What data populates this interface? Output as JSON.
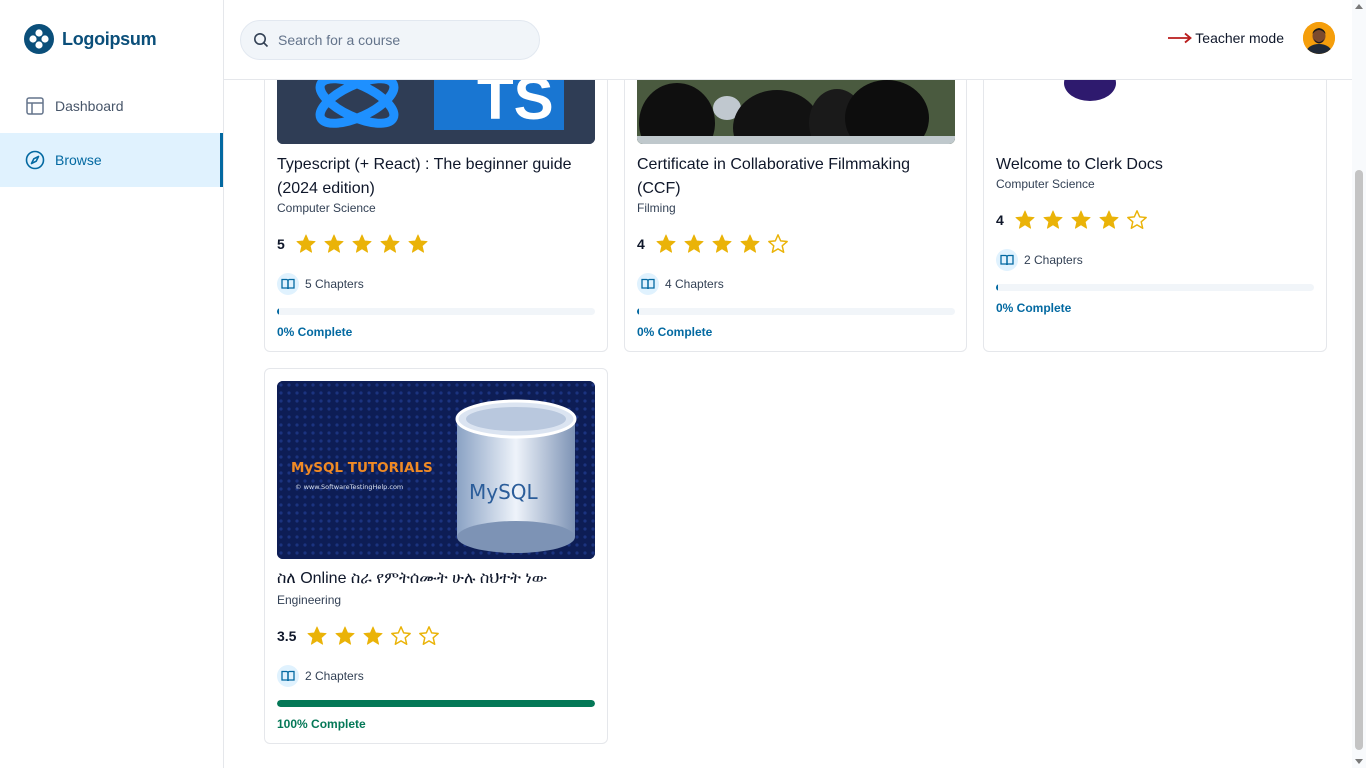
{
  "app": {
    "logo_text": "Logoipsum",
    "brand_color": "#0b4f7a",
    "accent_color": "#0369a1",
    "complete_color": "#047857"
  },
  "sidebar": {
    "items": [
      {
        "label": "Dashboard",
        "icon": "layout-icon",
        "active": false
      },
      {
        "label": "Browse",
        "icon": "compass-icon",
        "active": true
      }
    ]
  },
  "header": {
    "search_placeholder": "Search for a course",
    "teacher_mode_label": "Teacher mode"
  },
  "courses": [
    {
      "title": "Typescript (+ React) : The beginner guide (2024 edition)",
      "category": "Computer Science",
      "rating": 5,
      "rating_label": "5",
      "chapters": "5 Chapters",
      "progress": 0,
      "progress_label": "0% Complete"
    },
    {
      "title": "Certificate in Collaborative Filmmaking (CCF)",
      "category": "Filming",
      "rating": 4,
      "rating_label": "4",
      "chapters": "4 Chapters",
      "progress": 0,
      "progress_label": "0% Complete"
    },
    {
      "title": "Welcome to Clerk Docs",
      "category": "Computer Science",
      "rating": 4,
      "rating_label": "4",
      "chapters": "2 Chapters",
      "progress": 0,
      "progress_label": "0% Complete"
    },
    {
      "title": "ስለ Online ስራ የምትሰሙት ሁሉ ስህተት ነው",
      "category": "Engineering",
      "rating": 3.5,
      "rating_label": "3.5",
      "chapters": "2 Chapters",
      "progress": 100,
      "progress_label": "100% Complete"
    }
  ],
  "thumbnails": {
    "mysql_title": "MySQL TUTORIALS",
    "mysql_url": "© www.SoftwareTestingHelp.com",
    "mysql_logo": "MySQL",
    "ts_label": "TS"
  }
}
